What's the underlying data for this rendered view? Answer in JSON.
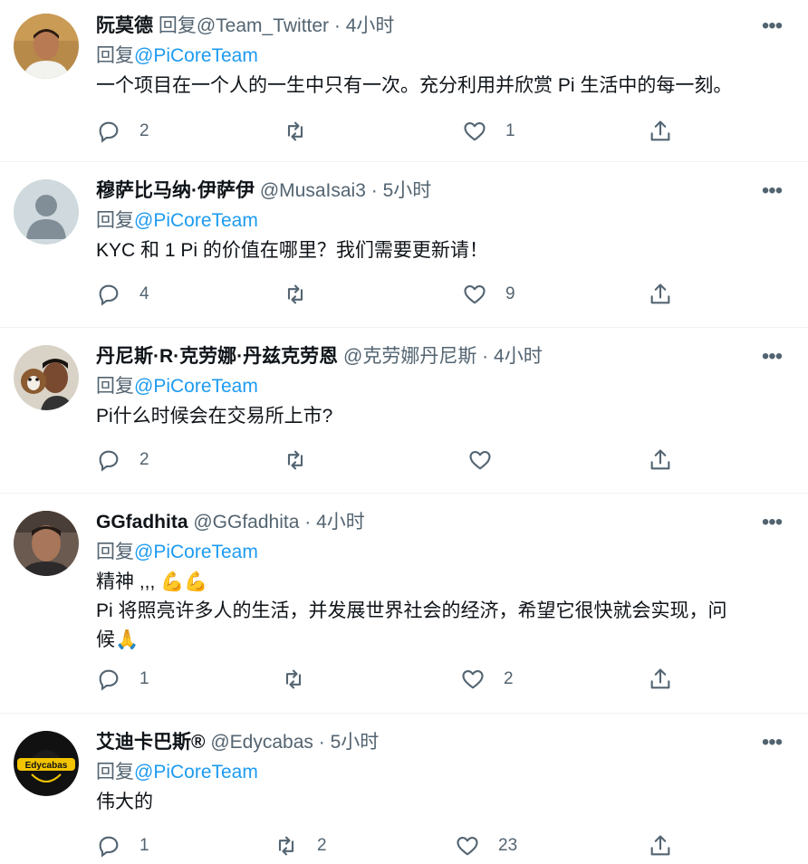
{
  "tweets": [
    {
      "name": "阮莫德",
      "handle": "回复@Team_Twitter",
      "dot": "·",
      "time": "4小时",
      "reply_prefix": "回复",
      "reply_to": "@PiCoreTeam",
      "text_lines": [
        "一个项目在一个人的一生中只有一次。充分利用并欣赏 Pi 生活中的每一刻。"
      ],
      "replies": "2",
      "retweets": "",
      "likes": "1",
      "avatar": "man-photo-avatar"
    },
    {
      "name": "穆萨比马纳·伊萨伊",
      "handle": "@MusaIsai3",
      "dot": "·",
      "time": "5小时",
      "reply_prefix": "回复",
      "reply_to": "@PiCoreTeam",
      "text_lines": [
        "KYC 和 1 Pi 的价值在哪里？我们需要更新请！"
      ],
      "replies": "4",
      "retweets": "",
      "likes": "9",
      "avatar": "default-avatar"
    },
    {
      "name": "丹尼斯·R·克劳娜·丹兹克劳恩",
      "handle": "@克劳娜丹尼斯",
      "dot": "·",
      "time": "4小时",
      "reply_prefix": "回复",
      "reply_to": "@PiCoreTeam",
      "text_lines": [
        "Pi什么时候会在交易所上市?"
      ],
      "replies": "2",
      "retweets": "",
      "likes": "",
      "avatar": "person-with-dog-avatar"
    },
    {
      "name": "GGfadhita",
      "handle": "@GGfadhita",
      "dot": "·",
      "time": "4小时",
      "reply_prefix": "回复",
      "reply_to": "@PiCoreTeam",
      "text_lines": [
        "精神 ,,, 💪💪",
        "Pi 将照亮许多人的生活，并发展世界社会的经济，希望它很快就会实现，问",
        "候🙏"
      ],
      "replies": "1",
      "retweets": "",
      "likes": "2",
      "avatar": "man-photo-avatar"
    },
    {
      "name": "艾迪卡巴斯®",
      "handle": "@Edycabas",
      "dot": "·",
      "time": "5小时",
      "reply_prefix": "回复",
      "reply_to": "@PiCoreTeam",
      "text_lines": [
        "伟大的"
      ],
      "replies": "1",
      "retweets": "2",
      "likes": "23",
      "avatar": "edycabas-logo-avatar",
      "avatar_text": "Edycabas"
    }
  ],
  "more_label": "•••",
  "colors": {
    "text": "#0f1419",
    "secondary": "#536471",
    "link": "#1d9bf0",
    "border": "#eff3f4"
  }
}
